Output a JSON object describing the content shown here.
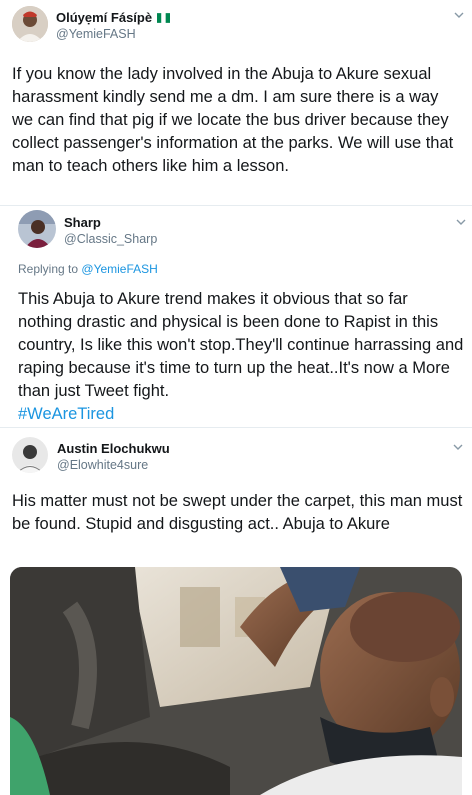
{
  "tweets": [
    {
      "name": "Olúyẹmí Fásípè",
      "handle": "@YemieFASH",
      "text": "If you know the lady involved in the Abuja to Akure sexual harassment kindly send me a dm. I am sure there is a way we can find that pig if we locate the bus driver because they collect passenger's information at the parks. We will use that man to teach others like him a lesson.",
      "flag_colors": [
        "#008751",
        "#ffffff",
        "#008751"
      ]
    },
    {
      "name": "Sharp",
      "handle": "@Classic_Sharp",
      "reply_prefix": "Replying to",
      "reply_to": "@YemieFASH",
      "text": "This Abuja to Akure trend makes it obvious that so far nothing drastic and physical is been done to Rapist in this country, Is like this won't stop.They'll continue harrassing and raping because it's time to turn up the heat..It's now a More than just Tweet fight.",
      "hashtag": "#WeAreTired"
    },
    {
      "name": "Austin Elochukwu",
      "handle": "@Elowhite4sure",
      "text": "His matter must not be swept under the carpet, this man must be found. Stupid and disgusting act.. Abuja to Akure"
    }
  ],
  "colors": {
    "link": "#1b95e0",
    "secondary": "#657786",
    "divider": "#e6ecf0"
  },
  "icons": [
    "chevron-down-icon",
    "nigeria-flag-icon"
  ]
}
